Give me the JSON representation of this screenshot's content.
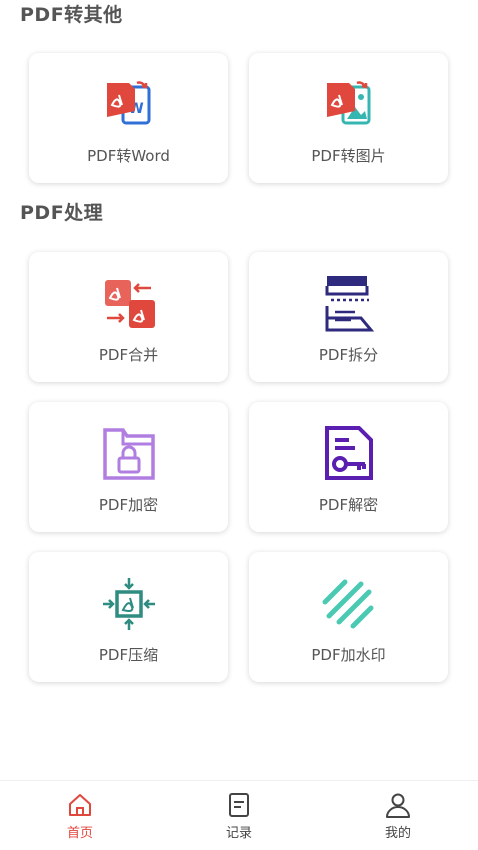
{
  "sections": {
    "convert": {
      "title": "PDF转其他"
    },
    "process": {
      "title": "PDF处理"
    }
  },
  "cards": {
    "pdf_to_word": {
      "label": "PDF转Word",
      "icon": "pdf-to-word-icon"
    },
    "pdf_to_image": {
      "label": "PDF转图片",
      "icon": "pdf-to-image-icon"
    },
    "pdf_merge": {
      "label": "PDF合并",
      "icon": "pdf-merge-icon"
    },
    "pdf_split": {
      "label": "PDF拆分",
      "icon": "pdf-split-icon"
    },
    "pdf_encrypt": {
      "label": "PDF加密",
      "icon": "folder-lock-icon"
    },
    "pdf_decrypt": {
      "label": "PDF解密",
      "icon": "document-key-icon"
    },
    "pdf_compress": {
      "label": "PDF压缩",
      "icon": "compress-icon"
    },
    "pdf_watermark": {
      "label": "PDF加水印",
      "icon": "watermark-icon"
    }
  },
  "tabbar": {
    "home": {
      "label": "首页",
      "icon": "home-icon",
      "active": true
    },
    "records": {
      "label": "记录",
      "icon": "record-icon",
      "active": false
    },
    "mine": {
      "label": "我的",
      "icon": "user-icon",
      "active": false
    }
  },
  "colors": {
    "accent": "#e0483e",
    "word_blue": "#2f6fd6",
    "image_teal": "#36b6b0",
    "split_navy": "#2e2a7e",
    "encrypt_purple": "#b07ee0",
    "decrypt_purple": "#5a1fb0",
    "compress_teal": "#2e8c80",
    "watermark_teal": "#4cc9b3"
  }
}
